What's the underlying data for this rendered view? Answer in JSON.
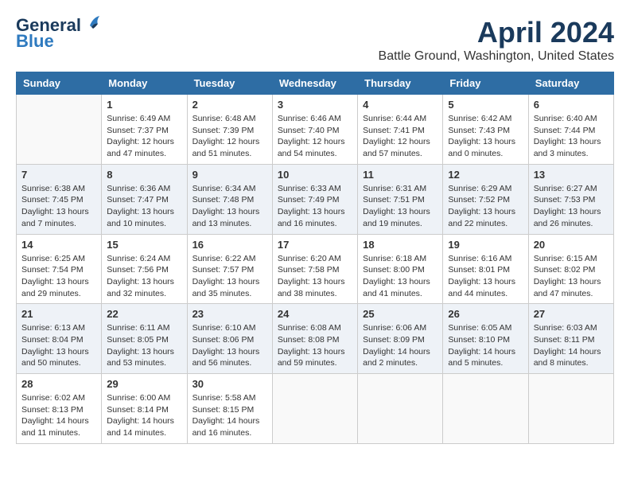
{
  "logo": {
    "line1": "General",
    "line2": "Blue"
  },
  "title": "April 2024",
  "location": "Battle Ground, Washington, United States",
  "days_of_week": [
    "Sunday",
    "Monday",
    "Tuesday",
    "Wednesday",
    "Thursday",
    "Friday",
    "Saturday"
  ],
  "weeks": [
    [
      {
        "day": "",
        "empty": true
      },
      {
        "day": "1",
        "sunrise": "6:49 AM",
        "sunset": "7:37 PM",
        "daylight": "12 hours and 47 minutes."
      },
      {
        "day": "2",
        "sunrise": "6:48 AM",
        "sunset": "7:39 PM",
        "daylight": "12 hours and 51 minutes."
      },
      {
        "day": "3",
        "sunrise": "6:46 AM",
        "sunset": "7:40 PM",
        "daylight": "12 hours and 54 minutes."
      },
      {
        "day": "4",
        "sunrise": "6:44 AM",
        "sunset": "7:41 PM",
        "daylight": "12 hours and 57 minutes."
      },
      {
        "day": "5",
        "sunrise": "6:42 AM",
        "sunset": "7:43 PM",
        "daylight": "13 hours and 0 minutes."
      },
      {
        "day": "6",
        "sunrise": "6:40 AM",
        "sunset": "7:44 PM",
        "daylight": "13 hours and 3 minutes."
      }
    ],
    [
      {
        "day": "7",
        "sunrise": "6:38 AM",
        "sunset": "7:45 PM",
        "daylight": "13 hours and 7 minutes."
      },
      {
        "day": "8",
        "sunrise": "6:36 AM",
        "sunset": "7:47 PM",
        "daylight": "13 hours and 10 minutes."
      },
      {
        "day": "9",
        "sunrise": "6:34 AM",
        "sunset": "7:48 PM",
        "daylight": "13 hours and 13 minutes."
      },
      {
        "day": "10",
        "sunrise": "6:33 AM",
        "sunset": "7:49 PM",
        "daylight": "13 hours and 16 minutes."
      },
      {
        "day": "11",
        "sunrise": "6:31 AM",
        "sunset": "7:51 PM",
        "daylight": "13 hours and 19 minutes."
      },
      {
        "day": "12",
        "sunrise": "6:29 AM",
        "sunset": "7:52 PM",
        "daylight": "13 hours and 22 minutes."
      },
      {
        "day": "13",
        "sunrise": "6:27 AM",
        "sunset": "7:53 PM",
        "daylight": "13 hours and 26 minutes."
      }
    ],
    [
      {
        "day": "14",
        "sunrise": "6:25 AM",
        "sunset": "7:54 PM",
        "daylight": "13 hours and 29 minutes."
      },
      {
        "day": "15",
        "sunrise": "6:24 AM",
        "sunset": "7:56 PM",
        "daylight": "13 hours and 32 minutes."
      },
      {
        "day": "16",
        "sunrise": "6:22 AM",
        "sunset": "7:57 PM",
        "daylight": "13 hours and 35 minutes."
      },
      {
        "day": "17",
        "sunrise": "6:20 AM",
        "sunset": "7:58 PM",
        "daylight": "13 hours and 38 minutes."
      },
      {
        "day": "18",
        "sunrise": "6:18 AM",
        "sunset": "8:00 PM",
        "daylight": "13 hours and 41 minutes."
      },
      {
        "day": "19",
        "sunrise": "6:16 AM",
        "sunset": "8:01 PM",
        "daylight": "13 hours and 44 minutes."
      },
      {
        "day": "20",
        "sunrise": "6:15 AM",
        "sunset": "8:02 PM",
        "daylight": "13 hours and 47 minutes."
      }
    ],
    [
      {
        "day": "21",
        "sunrise": "6:13 AM",
        "sunset": "8:04 PM",
        "daylight": "13 hours and 50 minutes."
      },
      {
        "day": "22",
        "sunrise": "6:11 AM",
        "sunset": "8:05 PM",
        "daylight": "13 hours and 53 minutes."
      },
      {
        "day": "23",
        "sunrise": "6:10 AM",
        "sunset": "8:06 PM",
        "daylight": "13 hours and 56 minutes."
      },
      {
        "day": "24",
        "sunrise": "6:08 AM",
        "sunset": "8:08 PM",
        "daylight": "13 hours and 59 minutes."
      },
      {
        "day": "25",
        "sunrise": "6:06 AM",
        "sunset": "8:09 PM",
        "daylight": "14 hours and 2 minutes."
      },
      {
        "day": "26",
        "sunrise": "6:05 AM",
        "sunset": "8:10 PM",
        "daylight": "14 hours and 5 minutes."
      },
      {
        "day": "27",
        "sunrise": "6:03 AM",
        "sunset": "8:11 PM",
        "daylight": "14 hours and 8 minutes."
      }
    ],
    [
      {
        "day": "28",
        "sunrise": "6:02 AM",
        "sunset": "8:13 PM",
        "daylight": "14 hours and 11 minutes."
      },
      {
        "day": "29",
        "sunrise": "6:00 AM",
        "sunset": "8:14 PM",
        "daylight": "14 hours and 14 minutes."
      },
      {
        "day": "30",
        "sunrise": "5:58 AM",
        "sunset": "8:15 PM",
        "daylight": "14 hours and 16 minutes."
      },
      {
        "day": "",
        "empty": true
      },
      {
        "day": "",
        "empty": true
      },
      {
        "day": "",
        "empty": true
      },
      {
        "day": "",
        "empty": true
      }
    ]
  ],
  "labels": {
    "sunrise": "Sunrise:",
    "sunset": "Sunset:",
    "daylight": "Daylight hours"
  }
}
